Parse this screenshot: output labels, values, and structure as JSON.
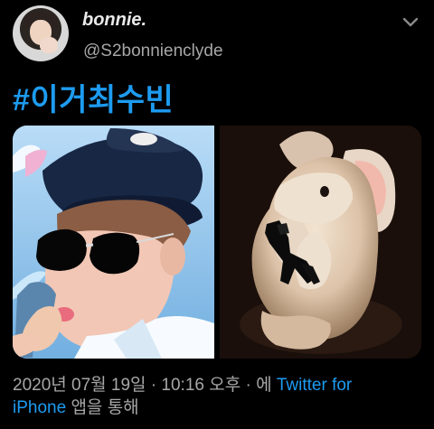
{
  "tweet": {
    "display_name": "bonnie.",
    "handle": "@S2bonnienclyde",
    "text": "#이거최수빈",
    "timestamp": {
      "prefix": "2020년 07월 19일 · 10:16 오후 · 에 ",
      "source_part1": "Twitter for",
      "source_part2": "iPhone",
      "suffix": " 앱을 통해"
    },
    "icons": {
      "avatar": "avatar-photo",
      "menu": "chevron-down-icon"
    }
  },
  "colors": {
    "link": "#1d9bf0",
    "text_primary": "#e9e9e9",
    "text_secondary": "#a7a7a7",
    "background": "#000000"
  },
  "media": {
    "left_image": "police-hat-photo",
    "right_image": "rabbit-with-gun-photo"
  }
}
